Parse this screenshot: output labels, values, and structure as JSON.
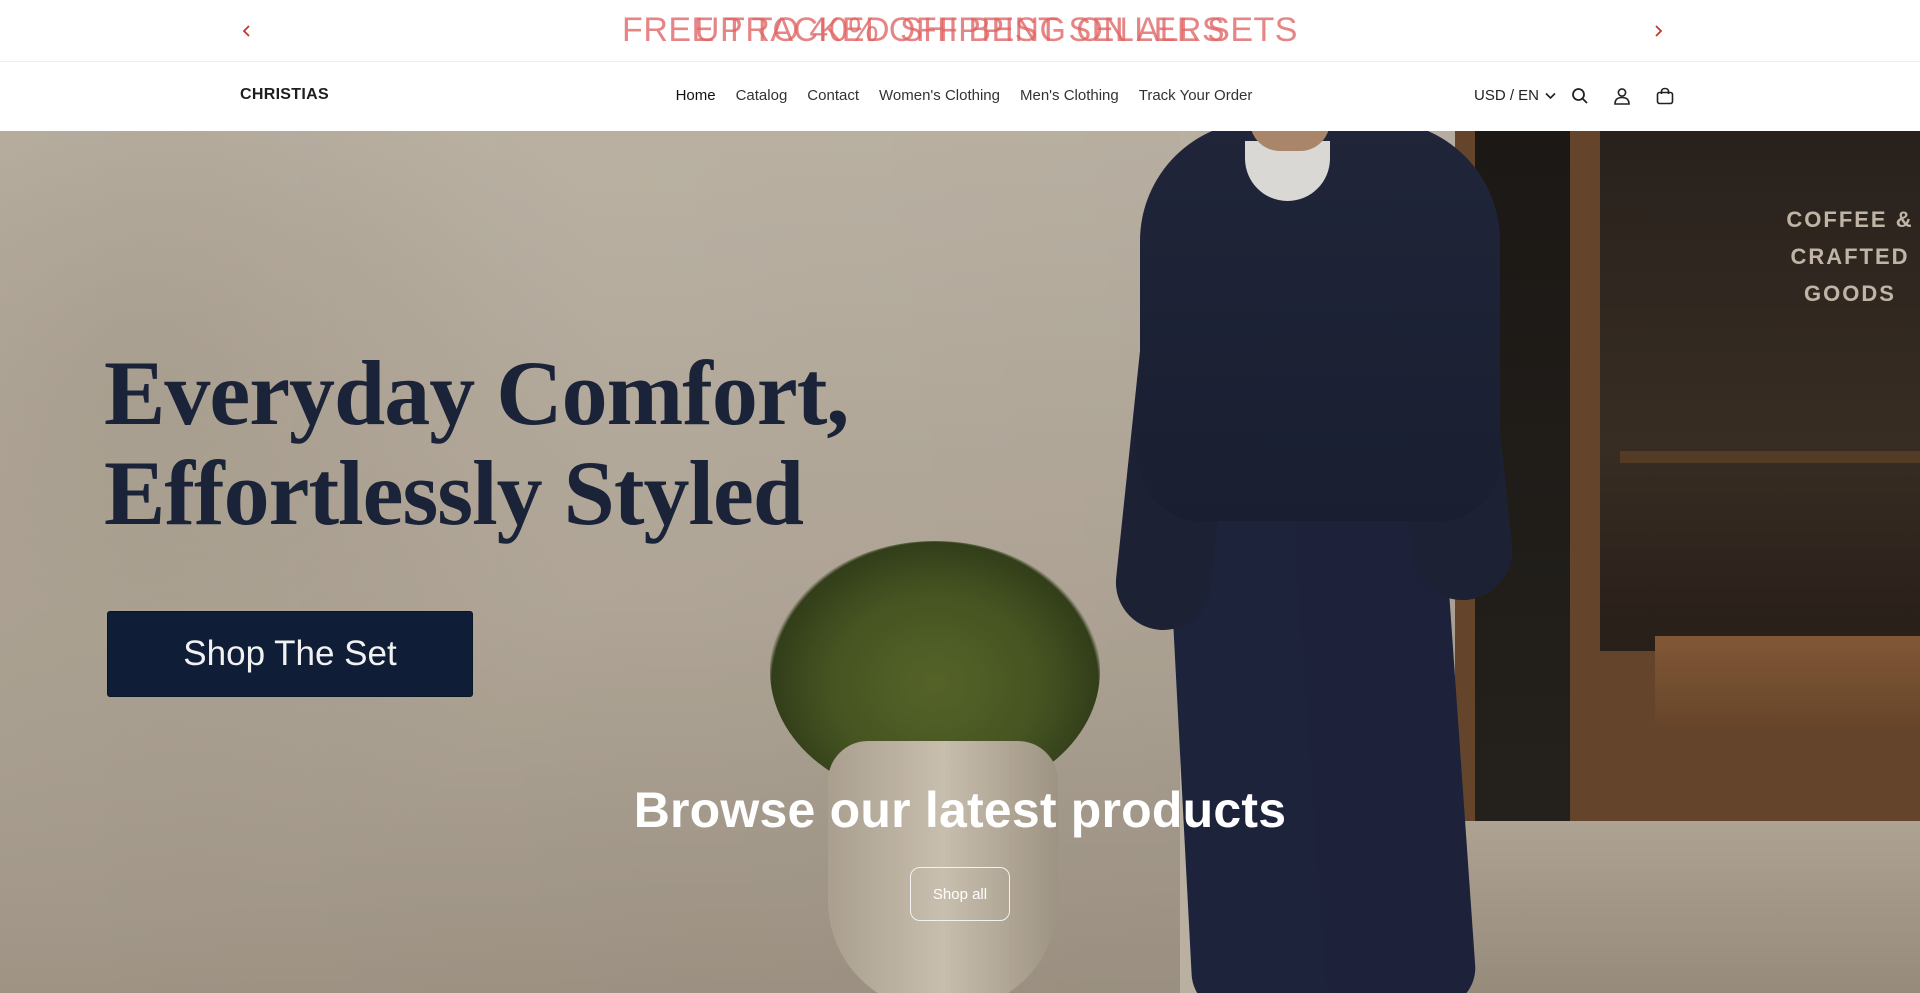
{
  "announcement": {
    "messages": [
      "FREE TRACKED SHIPPING ON ALL SETS",
      "UP TO 40% OFF BEST SELLERS"
    ],
    "prev_icon": "chevron-left-icon",
    "next_icon": "chevron-right-icon",
    "color": "#e06464"
  },
  "header": {
    "logo": "CHRISTIAS",
    "nav": [
      {
        "label": "Home"
      },
      {
        "label": "Catalog"
      },
      {
        "label": "Contact"
      },
      {
        "label": "Women's Clothing"
      },
      {
        "label": "Men's Clothing"
      },
      {
        "label": "Track Your Order"
      }
    ],
    "locale": "USD / EN",
    "icons": [
      "search-icon",
      "account-icon",
      "cart-icon"
    ]
  },
  "hero": {
    "headline_line1": "Everyday Comfort,",
    "headline_line2": "Effortlessly Styled",
    "cta": "Shop The Set",
    "window_sign": [
      "COFFEE &",
      "CRAFTED",
      "GOODS"
    ],
    "subheading": "Browse our latest products",
    "secondary_cta": "Shop all",
    "cta_color": "#0f1e36"
  }
}
